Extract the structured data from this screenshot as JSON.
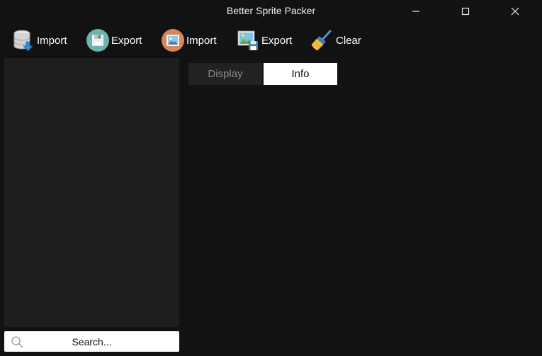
{
  "window": {
    "title": "Better Sprite Packer"
  },
  "toolbar": {
    "import_data_label": "Import",
    "export_data_label": "Export",
    "import_image_label": "Import",
    "export_image_label": "Export",
    "clear_label": "Clear"
  },
  "search": {
    "placeholder": "Search..."
  },
  "tabs": [
    {
      "label": "Display",
      "active": false
    },
    {
      "label": "Info",
      "active": true
    }
  ],
  "icons": {
    "minimize": "minimize-icon",
    "maximize": "maximize-icon",
    "close": "close-icon",
    "import_data": "database-import-icon",
    "export_data": "floppy-disk-icon",
    "import_image": "image-icon",
    "export_image": "image-save-icon",
    "clear": "broom-icon",
    "search": "search-icon"
  },
  "colors": {
    "background": "#121212",
    "sidebar": "#1e1e1e",
    "tab_inactive": "#222222",
    "tab_active": "#ffffff"
  }
}
